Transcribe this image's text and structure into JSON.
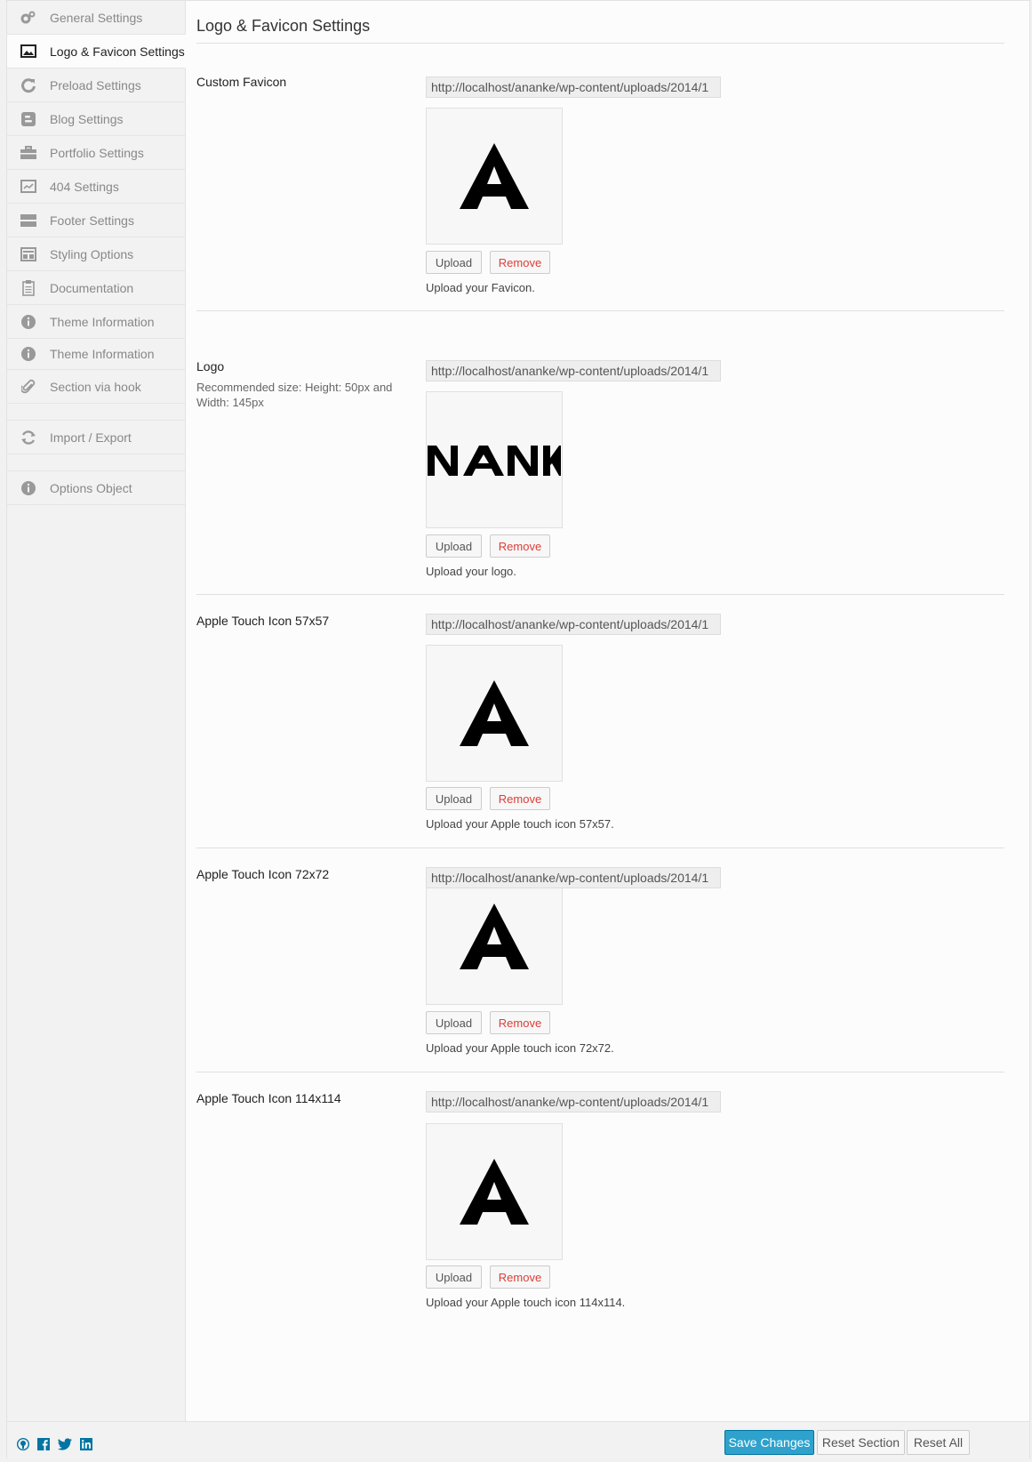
{
  "sidebar": {
    "items": [
      {
        "label": "General Settings",
        "icon": "gears-icon"
      },
      {
        "label": "Logo & Favicon Settings",
        "icon": "image-icon"
      },
      {
        "label": "Preload Settings",
        "icon": "refresh-icon"
      },
      {
        "label": "Blog Settings",
        "icon": "blogger-icon"
      },
      {
        "label": "Portfolio Settings",
        "icon": "briefcase-icon"
      },
      {
        "label": "404 Settings",
        "icon": "chart-icon"
      },
      {
        "label": "Footer Settings",
        "icon": "footer-icon"
      },
      {
        "label": "Styling Options",
        "icon": "layout-icon"
      },
      {
        "label": "Documentation",
        "icon": "clipboard-icon"
      },
      {
        "label": "Theme Information",
        "icon": "info-icon"
      },
      {
        "label": "Theme Information",
        "icon": "info-icon"
      },
      {
        "label": "Section via hook",
        "icon": "paperclip-icon"
      },
      {
        "label": "Import / Export",
        "icon": "sync-icon"
      },
      {
        "label": "Options Object",
        "icon": "info-icon"
      }
    ],
    "active_index": 1
  },
  "main": {
    "title": "Logo & Favicon Settings",
    "fields": [
      {
        "label": "Custom Favicon",
        "sublabel": "",
        "url": "http://localhost/ananke/wp-content/uploads/2014/1",
        "preview": "A",
        "upload": "Upload",
        "remove": "Remove",
        "desc": "Upload your Favicon."
      },
      {
        "label": "Logo",
        "sublabel": "Recommended size: Height: 50px and Width: 145px",
        "url": "http://localhost/ananke/wp-content/uploads/2014/1",
        "preview": "NANK",
        "upload": "Upload",
        "remove": "Remove",
        "desc": "Upload your logo."
      },
      {
        "label": "Apple Touch Icon 57x57",
        "sublabel": "",
        "url": "http://localhost/ananke/wp-content/uploads/2014/1",
        "preview": "A",
        "upload": "Upload",
        "remove": "Remove",
        "desc": "Upload your Apple touch icon 57x57."
      },
      {
        "label": "Apple Touch Icon 72x72",
        "sublabel": "",
        "url": "http://localhost/ananke/wp-content/uploads/2014/1",
        "preview": "A",
        "upload": "Upload",
        "remove": "Remove",
        "desc": "Upload your Apple touch icon 72x72."
      },
      {
        "label": "Apple Touch Icon 114x114",
        "sublabel": "",
        "url": "http://localhost/ananke/wp-content/uploads/2014/1",
        "preview": "A",
        "upload": "Upload",
        "remove": "Remove",
        "desc": "Upload your Apple touch icon 114x114."
      }
    ]
  },
  "footer": {
    "social_icons": [
      "github-icon",
      "facebook-icon",
      "twitter-icon",
      "linkedin-icon"
    ],
    "save": "Save Changes",
    "reset_section": "Reset Section",
    "reset_all": "Reset All"
  },
  "colors": {
    "accent": "#2ea2cc",
    "remove": "#dd3d36",
    "social": "#0074a2"
  }
}
